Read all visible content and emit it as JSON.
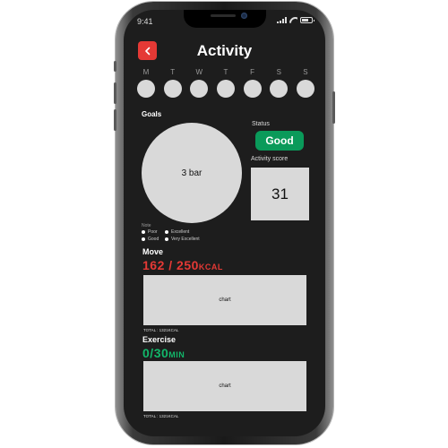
{
  "status_bar": {
    "time": "9:41"
  },
  "header": {
    "title": "Activity",
    "back_icon": "chevron-left-icon"
  },
  "week": {
    "days": [
      "M",
      "T",
      "W",
      "T",
      "F",
      "S",
      "S"
    ]
  },
  "goals": {
    "label": "Goals",
    "circle_text": "3 bar",
    "note_title": "Note",
    "legend": [
      "Poor",
      "Excellent",
      "Good",
      "Very Excellent"
    ]
  },
  "status": {
    "label": "Status",
    "value": "Good",
    "color": "#0a9a5a"
  },
  "activity_score": {
    "label": "Activity score",
    "value": "31"
  },
  "move": {
    "label": "Move",
    "current": "162",
    "separator": " / ",
    "goal": "250",
    "unit": "KCAL",
    "color": "#e53935",
    "chart_placeholder": "chart",
    "total": "TOTAL : 1321KCAL"
  },
  "exercise": {
    "label": "Exercise",
    "current": "0",
    "separator": "/",
    "goal": "30",
    "unit": "MIN",
    "color": "#12b76a",
    "chart_placeholder": "chart",
    "total": "TOTAL : 1321KCAL"
  }
}
